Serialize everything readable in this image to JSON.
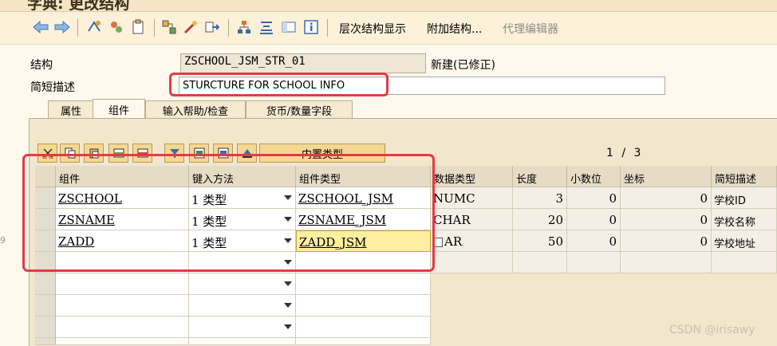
{
  "title": "字典: 更改结构",
  "toolbar": {
    "icons": [
      "back-icon",
      "forward-icon",
      "other-object-icon",
      "display-change-icon",
      "activate-icon",
      "check-icon",
      "test-icon",
      "where-used-icon",
      "object-list-icon",
      "navigation-icon",
      "info-icon"
    ],
    "hierarchy_display": "层次结构显示",
    "append_structure": "附加结构...",
    "proxy_editor": "代理编辑器"
  },
  "header": {
    "structure_label": "结构",
    "structure_value": "ZSCHOOL_JSM_STR_01",
    "status": "新建(已修正)",
    "short_desc_label": "简短描述",
    "short_desc_value": "STURCTURE FOR SCHOOL INFO"
  },
  "tabs": [
    {
      "label": "属性",
      "active": false
    },
    {
      "label": "组件",
      "active": true
    },
    {
      "label": "输入帮助/检查",
      "active": false
    },
    {
      "label": "货币/数量字段",
      "active": false
    }
  ],
  "table_toolbar": {
    "builtin_type": "内置类型",
    "page_current": "1",
    "page_sep": "/",
    "page_total": "3"
  },
  "grid": {
    "columns": [
      "组件",
      "键入方法",
      "组件类型",
      "数据类型",
      "长度",
      "小数位",
      "坐标",
      "简短描述"
    ],
    "rows": [
      {
        "component": "ZSCHOOL",
        "method": "1 类型",
        "comp_type": "ZSCHOOL_JSM",
        "data_type": "NUMC",
        "length": "3",
        "decimals": "0",
        "coord": "0",
        "desc": "学校ID"
      },
      {
        "component": "ZSNAME",
        "method": "1 类型",
        "comp_type": "ZSNAME_JSM",
        "data_type": "CHAR",
        "length": "20",
        "decimals": "0",
        "coord": "0",
        "desc": "学校名称"
      },
      {
        "component": "ZADD",
        "method": "1 类型",
        "comp_type": "ZADD_JSM",
        "data_type": "AR",
        "length": "50",
        "decimals": "0",
        "coord": "0",
        "desc": "学校地址"
      }
    ]
  },
  "watermark": "CSDN @irisawy",
  "left_mark": "9",
  "colors": {
    "highlight": "#e63946",
    "toolbar_bg": "#fdf1d9",
    "button_bg": "#f4d792"
  }
}
